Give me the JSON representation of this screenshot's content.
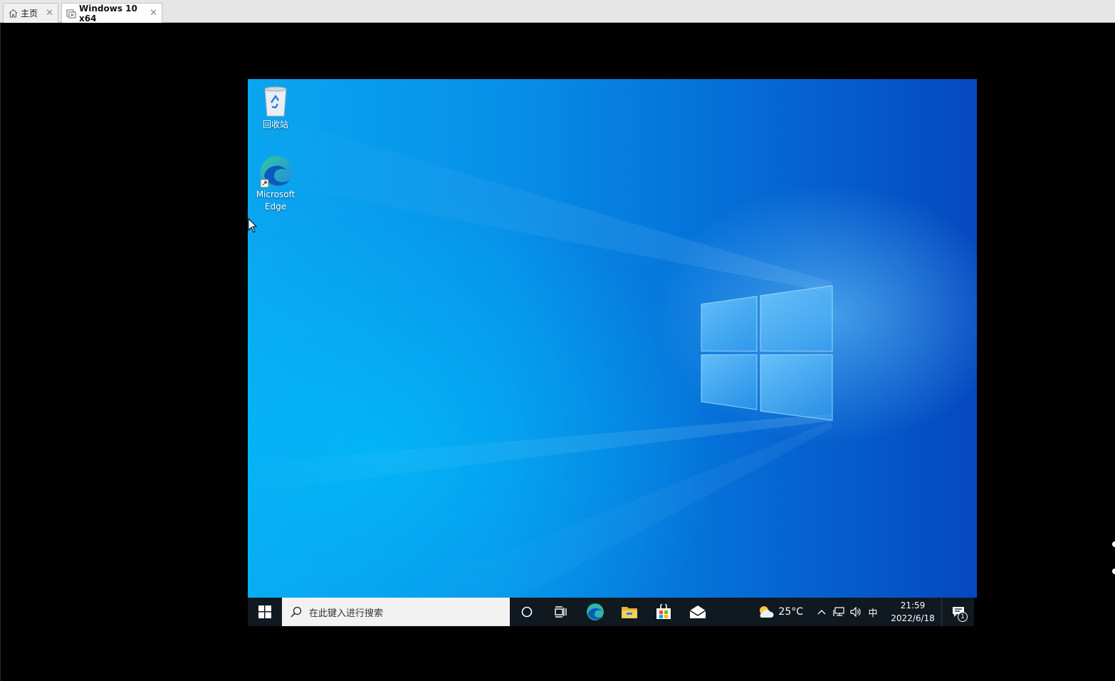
{
  "host": {
    "tabs": [
      {
        "label": "主页",
        "icon": "home-icon",
        "active": false
      },
      {
        "label": "Windows 10 x64",
        "icon": "vm-icon",
        "active": true
      }
    ]
  },
  "desktop": {
    "icons": [
      {
        "label": "回收站",
        "icon": "recycle-bin-icon"
      },
      {
        "label": "Microsoft Edge",
        "icon": "edge-icon"
      }
    ]
  },
  "taskbar": {
    "search_placeholder": "在此键入进行搜索",
    "apps": [
      "cortana-icon",
      "task-view-icon",
      "edge-icon",
      "file-explorer-icon",
      "store-icon",
      "mail-icon"
    ],
    "weather": "25°C",
    "ime": "中",
    "time": "21:59",
    "date": "2022/6/18",
    "notification_count": "1"
  },
  "colors": {
    "taskbar_bg": "#101820",
    "wallpaper_accent": "#0790e8"
  }
}
